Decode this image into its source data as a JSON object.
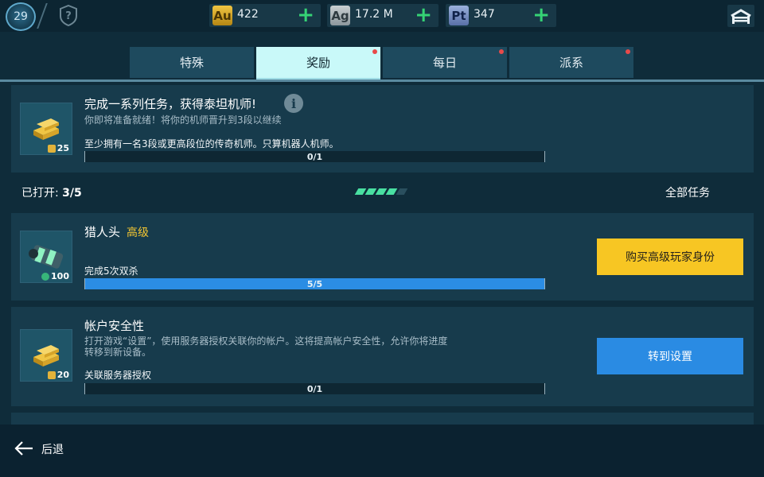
{
  "topbar": {
    "level": "29",
    "currencies": [
      {
        "code": "Au",
        "value": "422",
        "color": "#e2b33b"
      },
      {
        "code": "Ag",
        "value": "17.2 M",
        "color": "#aeb6ba"
      },
      {
        "code": "Pt",
        "value": "347",
        "color": "#7f97c9"
      }
    ],
    "plus": "+",
    "icons": {
      "help": "shield-question-icon",
      "garage": "hangar-icon",
      "add": "plus-icon"
    }
  },
  "tabs": [
    {
      "label": "特殊",
      "active": false,
      "notify": false
    },
    {
      "label": "奖励",
      "active": true,
      "notify": true
    },
    {
      "label": "每日",
      "active": false,
      "notify": true
    },
    {
      "label": "派系",
      "active": false,
      "notify": true
    }
  ],
  "featured": {
    "title": "完成一系列任务，获得泰坦机师!",
    "subtitle": "你即将准备就绪！将你的机师晋升到3段以继续",
    "goal": "至少拥有一名3段或更高段位的传奇机师。只算机器人机师。",
    "progress": "0/1",
    "progress_fraction": 0,
    "reward": {
      "icon": "gold-bars-icon",
      "amount": "25"
    }
  },
  "opened": {
    "label": "已打开:",
    "value": "3/5",
    "filled": 4,
    "total": 5,
    "all_tasks": "全部任务"
  },
  "tasks": [
    {
      "title": "猎人头",
      "tier": "高级",
      "goal": "完成5次双杀",
      "progress": "5/5",
      "progress_fraction": 1,
      "reward": {
        "icon": "booster-canister-icon",
        "amount": "100"
      },
      "button": "购买高级玩家身份"
    },
    {
      "title": "帐户安全性",
      "subtitle_line1": "打开游戏“设置”，使用服务器授权关联你的帐户。这将提高帐户安全性，允许你将进度",
      "subtitle_line2": "转移到新设备。",
      "goal": "关联服务器授权",
      "progress": "0/1",
      "progress_fraction": 0,
      "reward": {
        "icon": "gold-bars-icon",
        "amount": "20"
      },
      "button": "转到设置"
    }
  ],
  "bottom": {
    "back_label": "后退",
    "back_icon": "arrow-left-icon"
  }
}
